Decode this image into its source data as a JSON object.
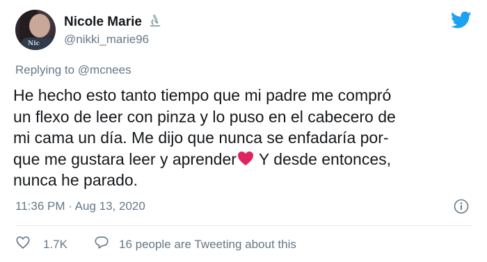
{
  "author": {
    "display_name": "Nicole Marie",
    "handle": "@nikki_marie96",
    "avatar_shirt_text": "Nic",
    "name_emoji_icon": "microscope-icon"
  },
  "replying_to": {
    "prefix": "Replying to",
    "mention": "@mcnees"
  },
  "tweet": {
    "lines": [
      "He hecho esto tanto tiempo que mi padre me compró",
      "un flexo de leer con pinza y lo puso en el cabecero de",
      "mi cama un día. Me dijo que nunca se enfadaría por-",
      "que me gustara leer y aprender",
      " Y desde entonces,",
      "nunca he parado."
    ],
    "emoji": "red-heart-icon"
  },
  "meta": {
    "timestamp": "11:36 PM · Aug 13, 2020"
  },
  "actions": {
    "likes": "1.7K",
    "reply_text": "16 people are Tweeting about this"
  },
  "colors": {
    "twitter_blue": "#1da1f2",
    "secondary_text": "#657786",
    "heart_red": "#e0245e",
    "divider": "#e1e8ed"
  }
}
